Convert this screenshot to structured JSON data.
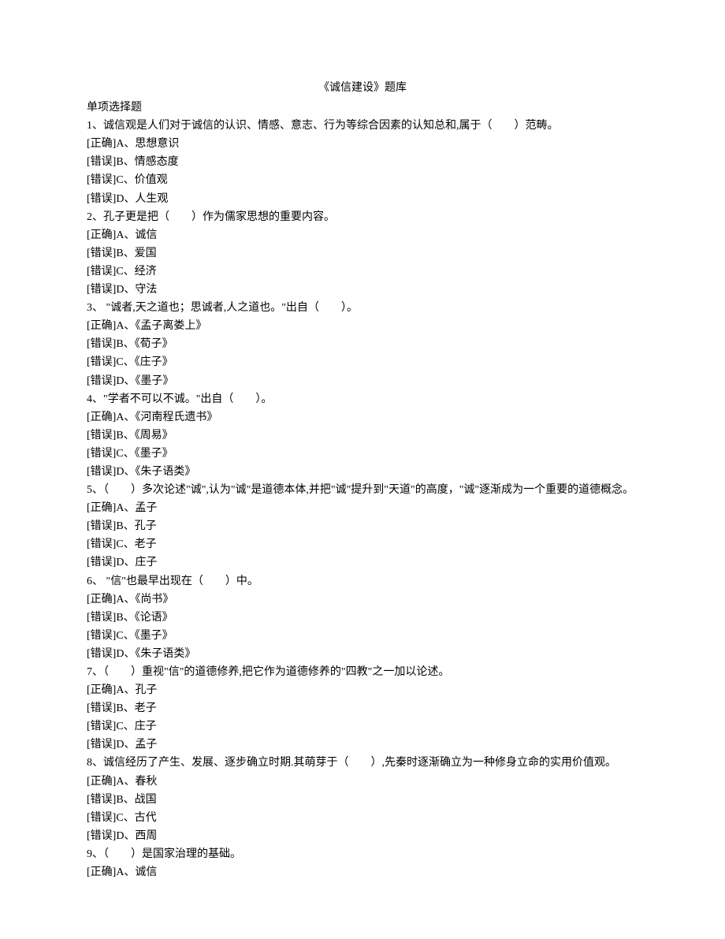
{
  "title": "《诚信建设》题库",
  "section_header": "单项选择题",
  "questions": [
    {
      "stem": "1、诚信观是人们对于诚信的认识、情感、意志、行为等综合因素的认知总和,属于（　　）范畴。",
      "options": [
        "[正确]A、思想意识",
        "[错误]B、情感态度",
        "[错误]C、价值观",
        "[错误]D、人生观"
      ]
    },
    {
      "stem": "2、孔子更是把（　　）作为儒家思想的重要内容。",
      "options": [
        "[正确]A、诚信",
        "[错误]B、爱国",
        "[错误]C、经济",
        "[错误]D、守法"
      ]
    },
    {
      "stem": "3、 \"诚者,天之道也；思诚者,人之道也。\"出自（　　）。",
      "options": [
        "[正确]A、《孟子离娄上》",
        "[错误]B、《荀子》",
        "[错误]C、《庄子》",
        "[错误]D、《墨子》"
      ]
    },
    {
      "stem": "4、\"学者不可以不诚。\"出自（　　）。",
      "options": [
        "[正确]A、《河南程氏遗书》",
        "[错误]B、《周易》",
        "[错误]C、《墨子》",
        "[错误]D、《朱子语类》"
      ]
    },
    {
      "stem": "5、（　　）多次论述\"诚\",认为\"诚\"是道德本体,并把\"诚\"提升到\"天道\"的高度，\"诚\"逐渐成为一个重要的道德概念。",
      "options": [
        "[正确]A、孟子",
        "[错误]B、孔子",
        "[错误]C、老子",
        "[错误]D、庄子"
      ]
    },
    {
      "stem": "6、 \"信\"也最早出现在（　　）中。",
      "options": [
        "[正确]A、《尚书》",
        "[错误]B、《论语》",
        "[错误]C、《墨子》",
        "[错误]D、《朱子语类》"
      ]
    },
    {
      "stem": "7、（　　）重视\"信\"的道德修养,把它作为道德修养的\"四教\"之一加以论述。",
      "options": [
        "[正确]A、孔子",
        "[错误]B、老子",
        "[错误]C、庄子",
        "[错误]D、孟子"
      ]
    },
    {
      "stem": "8、诚信经历了产生、发展、逐步确立时期.其萌芽于（　　）,先秦时逐渐确立为一种修身立命的实用价值观。",
      "options": [
        "[正确]A、春秋",
        "[错误]B、战国",
        "[错误]C、古代",
        "[错误]D、西周"
      ]
    },
    {
      "stem": "9、（　　）是国家治理的基础。",
      "options": [
        "[正确]A、诚信"
      ]
    }
  ]
}
